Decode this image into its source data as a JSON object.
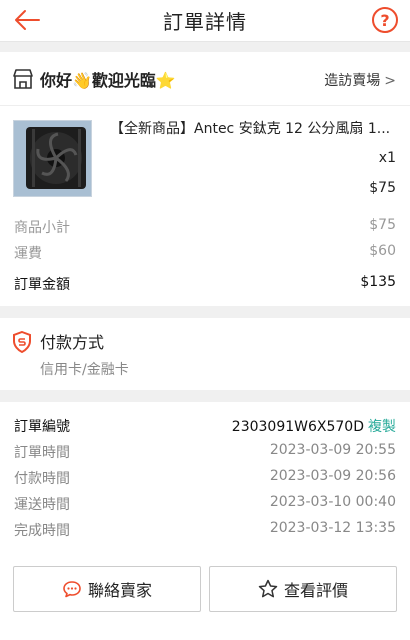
{
  "header": {
    "title": "訂單詳情",
    "help_label": "?"
  },
  "shop": {
    "name": "你好👋歡迎光臨⭐",
    "visit_label": "造訪賣場",
    "chevron": ">"
  },
  "product": {
    "name": "【全新商品】Antec 安鈦克 12 公分風扇 1...",
    "qty": "x1",
    "price": "$75"
  },
  "summary": [
    {
      "label": "商品小計",
      "value": "$75"
    },
    {
      "label": "運費",
      "value": "$60"
    },
    {
      "label": "訂單金額",
      "value": "$135"
    }
  ],
  "payment": {
    "title": "付款方式",
    "method": "信用卡/金融卡"
  },
  "order": {
    "id_label": "訂單編號",
    "id_value": "2303091W6X570D",
    "copy_label": "複製",
    "rows": [
      {
        "label": "訂單時間",
        "value": "2023-03-09 20:55"
      },
      {
        "label": "付款時間",
        "value": "2023-03-09 20:56"
      },
      {
        "label": "運送時間",
        "value": "2023-03-10 00:40"
      },
      {
        "label": "完成時間",
        "value": "2023-03-12 13:35"
      }
    ]
  },
  "actions": {
    "contact_label": "聯絡賣家",
    "review_label": "查看評價"
  },
  "colors": {
    "accent": "#ee4d2d",
    "copy": "#26aa99"
  },
  "icons": [
    "back-arrow-icon",
    "help-icon",
    "shop-icon",
    "shield-icon",
    "chat-icon",
    "star-icon"
  ]
}
